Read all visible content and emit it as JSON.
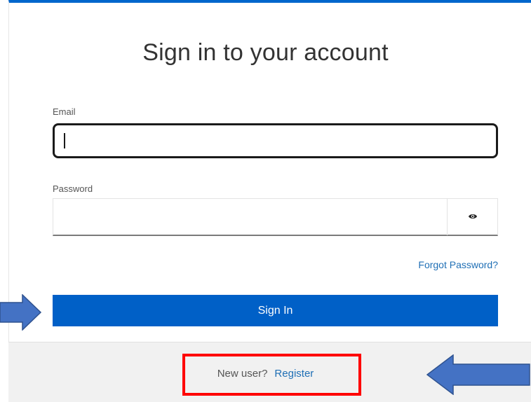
{
  "page": {
    "title": "Sign in to your account"
  },
  "form": {
    "email_label": "Email",
    "email_value": "",
    "password_label": "Password",
    "password_value": "",
    "show_password_icon": "eye-icon",
    "forgot_password": "Forgot Password?",
    "signin_button": "Sign In"
  },
  "footer": {
    "new_user_text": "New user?",
    "register_link": "Register"
  },
  "colors": {
    "accent": "#0060c7",
    "link": "#1f6fb5",
    "highlight_box": "#ff0000",
    "arrow": "#4472c4"
  },
  "annotations": {
    "left_arrow_icon": "arrow-right-icon",
    "right_arrow_icon": "arrow-left-icon"
  }
}
